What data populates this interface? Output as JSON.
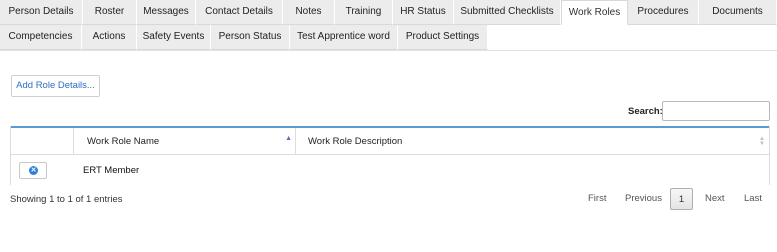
{
  "tabs_row1": [
    {
      "label": "Person Details"
    },
    {
      "label": "Roster"
    },
    {
      "label": "Messages"
    },
    {
      "label": "Contact Details"
    },
    {
      "label": "Notes"
    },
    {
      "label": "Training"
    },
    {
      "label": "HR Status"
    },
    {
      "label": "Submitted Checklists"
    },
    {
      "label": "Work Roles",
      "active": true
    },
    {
      "label": "Procedures"
    },
    {
      "label": "Documents"
    }
  ],
  "tabs_row2": [
    {
      "label": "Competencies"
    },
    {
      "label": "Actions"
    },
    {
      "label": "Safety Events"
    },
    {
      "label": "Person Status"
    },
    {
      "label": "Test Apprentice word"
    },
    {
      "label": "Product Settings"
    }
  ],
  "toolbar": {
    "add_label": "Add Role Details..."
  },
  "search": {
    "label": "Search:",
    "value": "",
    "placeholder": ""
  },
  "table": {
    "columns": [
      "",
      "Work Role Name",
      "Work Role Description"
    ],
    "sort_column": "Work Role Name",
    "sort_direction": "asc",
    "rows": [
      {
        "name": "ERT Member",
        "description": ""
      }
    ]
  },
  "info": "Showing 1 to 1 of 1 entries",
  "pagination": {
    "first": "First",
    "previous": "Previous",
    "current": "1",
    "next": "Next",
    "last": "Last"
  },
  "colors": {
    "accent": "#2a6fc4",
    "table_top_border": "#5b9bd5",
    "tab_bg": "#ececec",
    "delete_icon": "#2f7fd8"
  },
  "icons": {
    "delete": "remove-circle-icon",
    "sort_asc": "sort-asc-icon",
    "sort_both": "sort-both-icon"
  }
}
